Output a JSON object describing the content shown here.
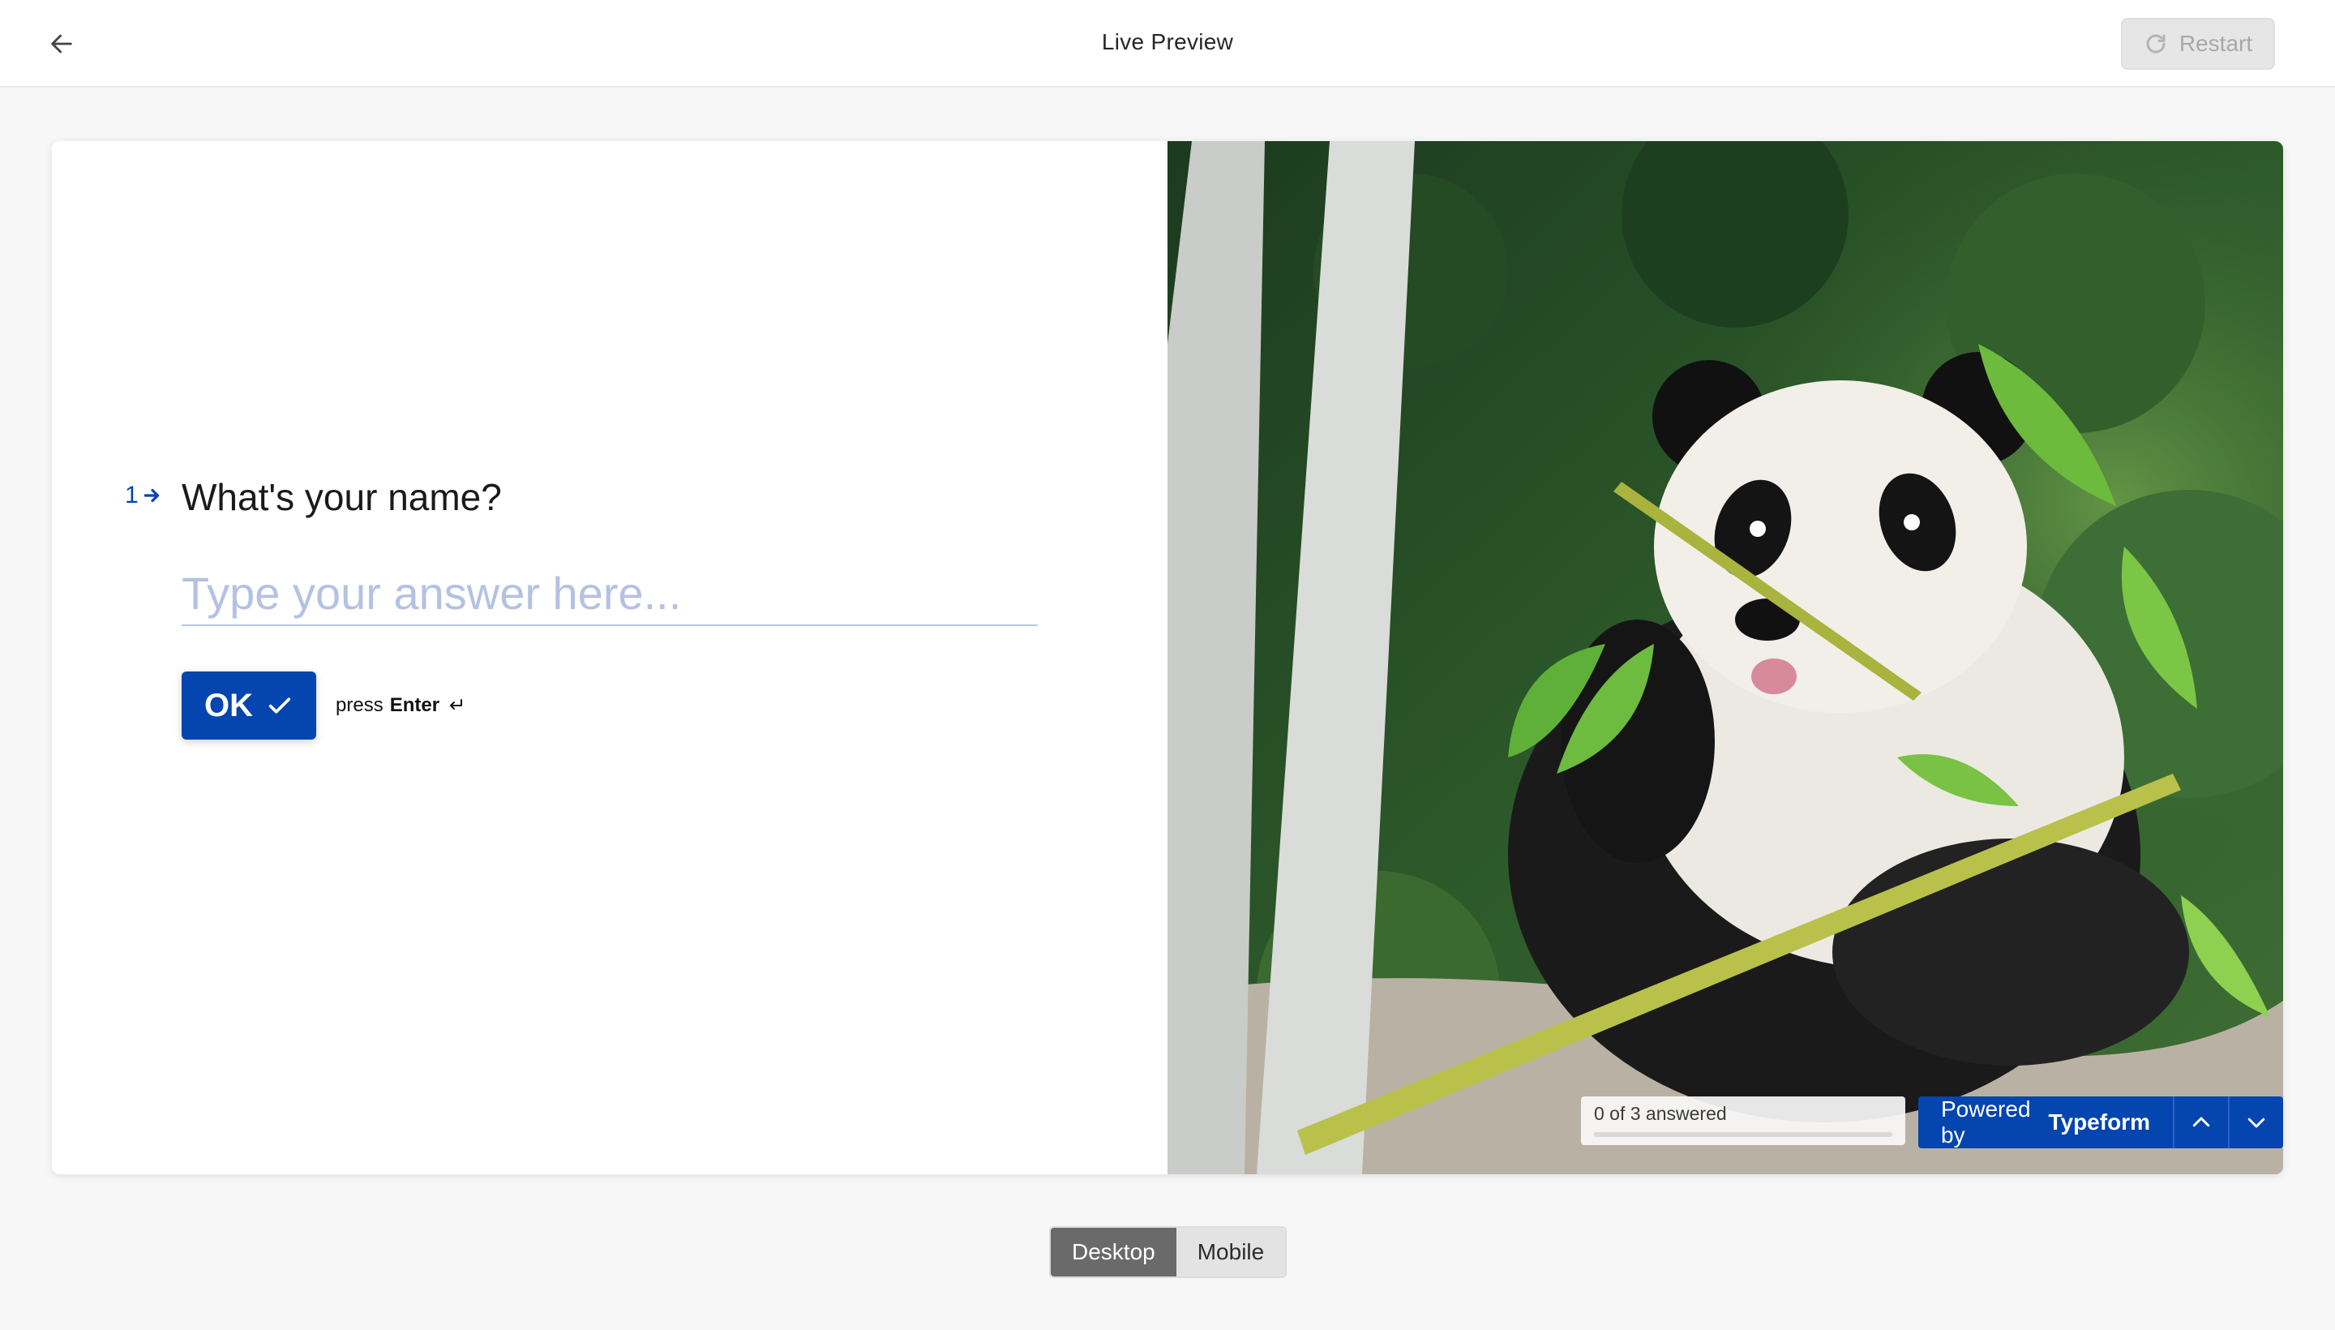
{
  "topbar": {
    "title": "Live Preview",
    "restart_label": "Restart"
  },
  "form": {
    "question_number": "1",
    "question_title": "What's your name?",
    "answer_placeholder": "Type your answer here...",
    "answer_value": "",
    "ok_label": "OK",
    "press_label": "press",
    "enter_label": "Enter"
  },
  "footer_nav": {
    "progress_text": "0 of 3 answered",
    "answered": 0,
    "total": 3,
    "powered_prefix": "Powered by",
    "powered_brand": "Typeform"
  },
  "view_toggle": {
    "desktop_label": "Desktop",
    "mobile_label": "Mobile",
    "selected": "Desktop"
  },
  "colors": {
    "accent": "#0445af",
    "placeholder": "#b3c2e3",
    "toggle_active": "#6a6a6a"
  },
  "icons": {
    "back": "arrow-left-icon",
    "restart": "refresh-icon",
    "question_arrow": "arrow-right-icon",
    "ok_check": "checkmark-icon",
    "enter": "enter-return-icon",
    "nav_up": "chevron-up-icon",
    "nav_down": "chevron-down-icon"
  }
}
